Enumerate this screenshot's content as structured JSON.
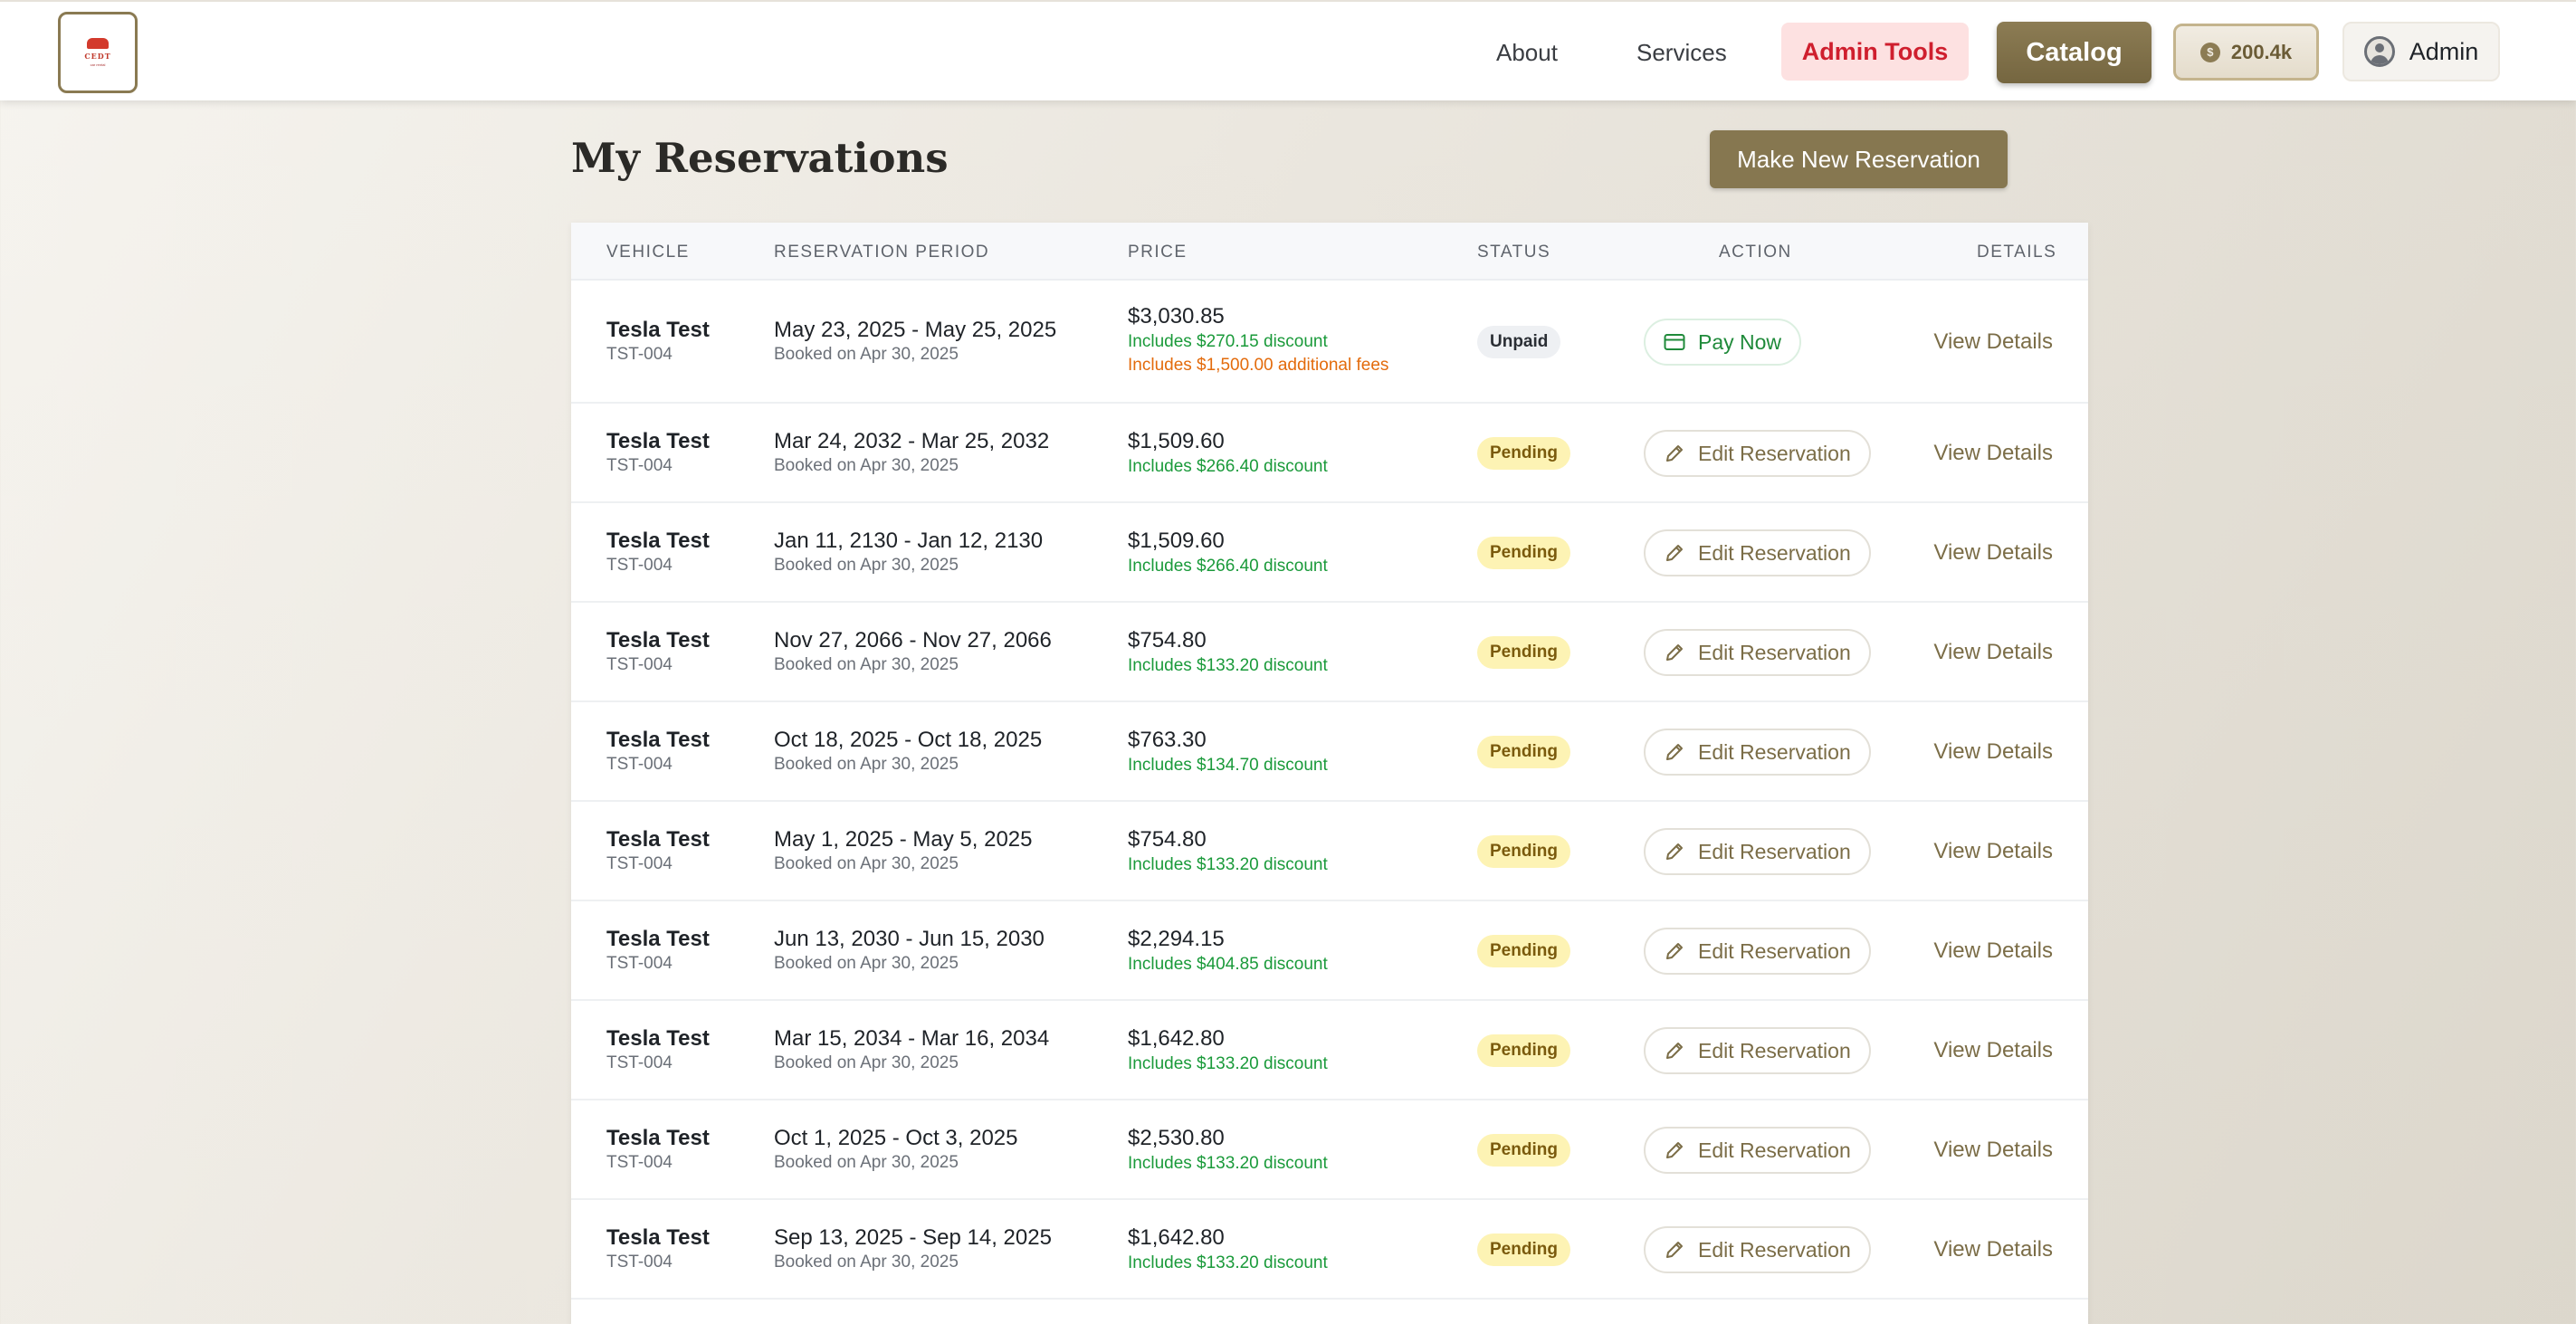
{
  "header": {
    "logo_text": "CEDT",
    "logo_sub": "car rental",
    "nav": [
      {
        "label": "About"
      },
      {
        "label": "Services"
      }
    ],
    "admin_tools_label": "Admin Tools",
    "catalog_label": "Catalog",
    "balance": "200.4k",
    "coin_symbol": "$",
    "user_label": "Admin"
  },
  "page": {
    "title": "My Reservations",
    "new_button_label": "Make New Reservation"
  },
  "table": {
    "columns": [
      "Vehicle",
      "Reservation Period",
      "Price",
      "Status",
      "Action",
      "Details"
    ],
    "rows": [
      {
        "vehicle": "Tesla Test",
        "plate": "TST-004",
        "period": "May 23, 2025 - May 25, 2025",
        "booked": "Booked on Apr 30, 2025",
        "price": "$3,030.85",
        "discount": "Includes $270.15 discount",
        "fees": "Includes $1,500.00 additional fees",
        "status": "Unpaid",
        "action": "Pay Now",
        "details": "View Details"
      },
      {
        "vehicle": "Tesla Test",
        "plate": "TST-004",
        "period": "Mar 24, 2032 - Mar 25, 2032",
        "booked": "Booked on Apr 30, 2025",
        "price": "$1,509.60",
        "discount": "Includes $266.40 discount",
        "status": "Pending",
        "action": "Edit Reservation",
        "details": "View Details"
      },
      {
        "vehicle": "Tesla Test",
        "plate": "TST-004",
        "period": "Jan 11, 2130 - Jan 12, 2130",
        "booked": "Booked on Apr 30, 2025",
        "price": "$1,509.60",
        "discount": "Includes $266.40 discount",
        "status": "Pending",
        "action": "Edit Reservation",
        "details": "View Details"
      },
      {
        "vehicle": "Tesla Test",
        "plate": "TST-004",
        "period": "Nov 27, 2066 - Nov 27, 2066",
        "booked": "Booked on Apr 30, 2025",
        "price": "$754.80",
        "discount": "Includes $133.20 discount",
        "status": "Pending",
        "action": "Edit Reservation",
        "details": "View Details"
      },
      {
        "vehicle": "Tesla Test",
        "plate": "TST-004",
        "period": "Oct 18, 2025 - Oct 18, 2025",
        "booked": "Booked on Apr 30, 2025",
        "price": "$763.30",
        "discount": "Includes $134.70 discount",
        "status": "Pending",
        "action": "Edit Reservation",
        "details": "View Details"
      },
      {
        "vehicle": "Tesla Test",
        "plate": "TST-004",
        "period": "May 1, 2025 - May 5, 2025",
        "booked": "Booked on Apr 30, 2025",
        "price": "$754.80",
        "discount": "Includes $133.20 discount",
        "status": "Pending",
        "action": "Edit Reservation",
        "details": "View Details"
      },
      {
        "vehicle": "Tesla Test",
        "plate": "TST-004",
        "period": "Jun 13, 2030 - Jun 15, 2030",
        "booked": "Booked on Apr 30, 2025",
        "price": "$2,294.15",
        "discount": "Includes $404.85 discount",
        "status": "Pending",
        "action": "Edit Reservation",
        "details": "View Details"
      },
      {
        "vehicle": "Tesla Test",
        "plate": "TST-004",
        "period": "Mar 15, 2034 - Mar 16, 2034",
        "booked": "Booked on Apr 30, 2025",
        "price": "$1,642.80",
        "discount": "Includes $133.20 discount",
        "status": "Pending",
        "action": "Edit Reservation",
        "details": "View Details"
      },
      {
        "vehicle": "Tesla Test",
        "plate": "TST-004",
        "period": "Oct 1, 2025 - Oct 3, 2025",
        "booked": "Booked on Apr 30, 2025",
        "price": "$2,530.80",
        "discount": "Includes $133.20 discount",
        "status": "Pending",
        "action": "Edit Reservation",
        "details": "View Details"
      },
      {
        "vehicle": "Tesla Test",
        "plate": "TST-004",
        "period": "Sep 13, 2025 - Sep 14, 2025",
        "booked": "Booked on Apr 30, 2025",
        "price": "$1,642.80",
        "discount": "Includes $133.20 discount",
        "status": "Pending",
        "action": "Edit Reservation",
        "details": "View Details"
      }
    ]
  }
}
